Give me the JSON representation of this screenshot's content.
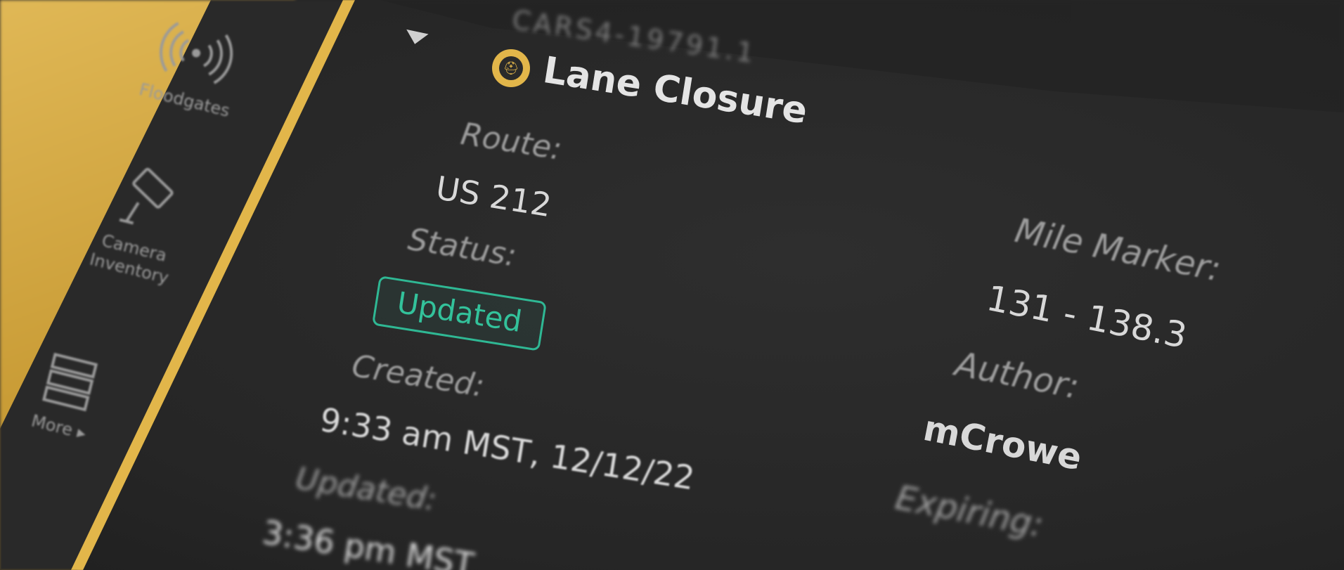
{
  "sidebar": {
    "items": [
      {
        "label": "Floodgates",
        "icon": "broadcast-icon"
      },
      {
        "label_line1": "Camera",
        "label_line2": "Inventory",
        "icon": "camera-icon"
      },
      {
        "label": "More ▸",
        "icon": "stack-icon"
      }
    ]
  },
  "event": {
    "id": "CARS4-19791.1",
    "title": "Lane Closure",
    "route_label": "Route:",
    "route": "US 212",
    "status_label": "Status:",
    "status": "Updated",
    "created_label": "Created:",
    "created": "9:33 am MST, 12/12/22",
    "updated_label": "Updated:",
    "updated": "3:36 pm MST",
    "mile_marker_label": "Mile Marker:",
    "mile_marker": "131 - 138.3",
    "author_label": "Author:",
    "author": "mCrowe",
    "expiring_label": "Expiring:"
  },
  "colors": {
    "accent": "#e2b64a",
    "status": "#33c29b"
  }
}
